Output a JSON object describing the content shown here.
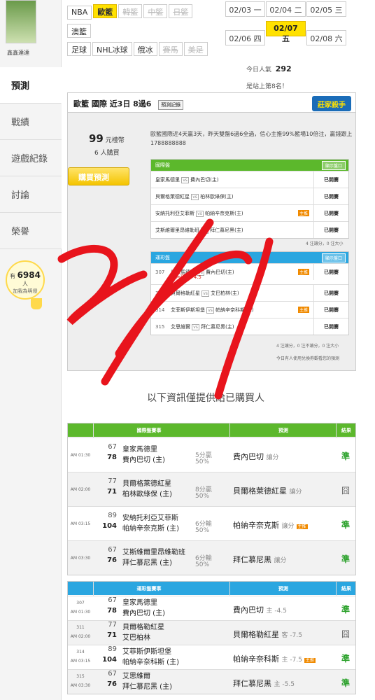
{
  "sidebar": {
    "user_name": "鑫鑫達達",
    "nav": [
      "預測",
      "戰績",
      "遊戲紀錄",
      "討論",
      "榮譽"
    ],
    "bulb_prefix": "有",
    "bulb_count": "6984",
    "bulb_suffix": "人",
    "bulb_sub": "加我為明燈"
  },
  "leagues": [
    {
      "label": "NBA",
      "state": "normal"
    },
    {
      "label": "歐籃",
      "state": "on"
    },
    {
      "label": "韓籃",
      "state": "disabled"
    },
    {
      "label": "中籃",
      "state": "disabled"
    },
    {
      "label": "日籃",
      "state": "disabled"
    },
    {
      "label": "澳籃",
      "state": "normal"
    },
    {
      "label": "足球",
      "state": "normal"
    },
    {
      "label": "NHL冰球",
      "state": "normal"
    },
    {
      "label": "俄冰",
      "state": "normal"
    },
    {
      "label": "賽馬",
      "state": "disabled"
    },
    {
      "label": "美足",
      "state": "disabled"
    }
  ],
  "dates": [
    {
      "label": "02/03 一",
      "on": false
    },
    {
      "label": "02/04 二",
      "on": false
    },
    {
      "label": "02/05 三",
      "on": false
    },
    {
      "label": "02/06 四",
      "on": false
    },
    {
      "label": "02/07 五",
      "on": true
    },
    {
      "label": "02/08 六",
      "on": false
    }
  ],
  "popularity": {
    "label": "今日人氣",
    "value": "292",
    "rank_text": "是站上第8名！"
  },
  "panel": {
    "title": "歐籃 國際 近3日 8過6",
    "record_btn": "預測記錄",
    "badge": "莊家殺手",
    "price_value": "99",
    "price_unit": "元禮幣",
    "buyers": "6 人購買",
    "buy_btn": "購買預測",
    "desc": "歐籃國際近4天贏3天，昨天雙盤6過6全過，信心主推99%籃場10倍注，贏錢跟上1788888888",
    "intl": {
      "header": "國際盤",
      "btn": "顯示盤口",
      "rows": [
        {
          "home": "皇家馬德里",
          "away": "費內巴切(主)",
          "status": "已開賽",
          "tag": ""
        },
        {
          "home": "貝爾格萊德紅星",
          "away": "柏林歐綠保(主)",
          "status": "已開賽",
          "tag": ""
        },
        {
          "home": "安納托利亞艾菲斯",
          "away": "帕納辛奈克斯(主)",
          "status": "已開賽",
          "tag": "主推"
        },
        {
          "home": "艾斯維爾里昂維勒班",
          "away": "拜仁慕尼黑(主)",
          "status": "已開賽",
          "tag": ""
        }
      ],
      "note": "4 注讓分，0 注大小"
    },
    "tw": {
      "header": "運彩盤",
      "btn": "顯示盤口",
      "rows": [
        {
          "no": "307",
          "home": "皇家馬德里",
          "away": "費內巴切(主)",
          "pick": "費內巴切 -4.5",
          "status": "已開賽",
          "tag": "主推"
        },
        {
          "no": "311",
          "home": "貝爾格勒紅星",
          "away": "艾巴柏林(主)",
          "pick": "",
          "status": "已開賽",
          "tag": ""
        },
        {
          "no": "314",
          "home": "艾菲斯伊斯坦堡",
          "away": "帕納辛奈科斯(主)",
          "pick": "",
          "status": "已開賽",
          "tag": "主推"
        },
        {
          "no": "315",
          "home": "艾思維爾",
          "away": "拜仁慕尼黑(主)",
          "pick": "",
          "status": "已開賽",
          "tag": ""
        }
      ],
      "note": "4 注讓分，0 注不讓分，0 注大小",
      "footer": "今日有人使用兌換券觀看您的預測"
    }
  },
  "free_title": "以下資訊僅提供給已購買人",
  "results_intl": {
    "headers": [
      "國際盤賽事",
      "預測",
      "結果"
    ],
    "rows": [
      {
        "time": "AM 01:30",
        "o1": "67",
        "o2": "78",
        "t1": "皇家馬德里",
        "t2": "費內巴切 (主)",
        "hc1": "5分贏",
        "hc2": "50%",
        "pick": "費內巴切",
        "pick_type": "讓分",
        "tag": "",
        "result": "準",
        "draw": false
      },
      {
        "time": "AM 02:00",
        "o1": "77",
        "o2": "71",
        "t1": "貝爾格萊德紅星",
        "t2": "柏林歐綠保 (主)",
        "hc1": "8分贏",
        "hc2": "50%",
        "pick": "貝爾格萊德紅星",
        "pick_type": "讓分",
        "tag": "",
        "result": "囧",
        "draw": true
      },
      {
        "time": "AM 03:15",
        "o1": "89",
        "o2": "104",
        "t1": "安納托利亞艾菲斯",
        "t2": "帕納辛奈克斯 (主)",
        "hc1": "6分輸",
        "hc2": "50%",
        "pick": "帕納辛奈克斯",
        "pick_type": "讓分",
        "tag": "主推",
        "result": "準",
        "draw": false
      },
      {
        "time": "AM 03:30",
        "o1": "67",
        "o2": "76",
        "t1": "艾斯維爾里昂維勒班",
        "t2": "拜仁慕尼黑 (主)",
        "hc1": "6分輸",
        "hc2": "50%",
        "pick": "拜仁慕尼黑",
        "pick_type": "讓分",
        "tag": "",
        "result": "準",
        "draw": false
      }
    ]
  },
  "results_tw": {
    "headers": [
      "運彩盤賽事",
      "預測",
      "結果"
    ],
    "rows": [
      {
        "no": "307",
        "time": "AM 01:30",
        "o1": "67",
        "o2": "78",
        "t1": "皇家馬德里",
        "t2": "費內巴切 (主)",
        "pick": "費內巴切",
        "pick_type": "主 -4.5",
        "tag": "",
        "result": "準",
        "draw": false
      },
      {
        "no": "311",
        "time": "AM 02:00",
        "o1": "77",
        "o2": "71",
        "t1": "貝爾格勒紅星",
        "t2": "艾巴柏林",
        "pick": "貝爾格勒紅星",
        "pick_type": "客 -7.5",
        "tag": "",
        "result": "囧",
        "draw": true
      },
      {
        "no": "314",
        "time": "AM 03:15",
        "o1": "89",
        "o2": "104",
        "t1": "艾菲斯伊斯坦堡",
        "t2": "帕納辛奈科斯 (主)",
        "pick": "帕納辛奈科斯",
        "pick_type": "主 -7.5",
        "tag": "主推",
        "result": "準",
        "draw": false
      },
      {
        "no": "315",
        "time": "AM 03:30",
        "o1": "67",
        "o2": "76",
        "t1": "艾思維爾",
        "t2": "拜仁慕尼黑 (主)",
        "pick": "拜仁慕尼黑",
        "pick_type": "主 -5.5",
        "tag": "",
        "result": "準",
        "draw": false
      }
    ]
  },
  "colors": {
    "green": "#5cb82c",
    "blue": "#2aa6e0",
    "yellow": "#ffe100",
    "red_stroke": "#e8141c"
  }
}
